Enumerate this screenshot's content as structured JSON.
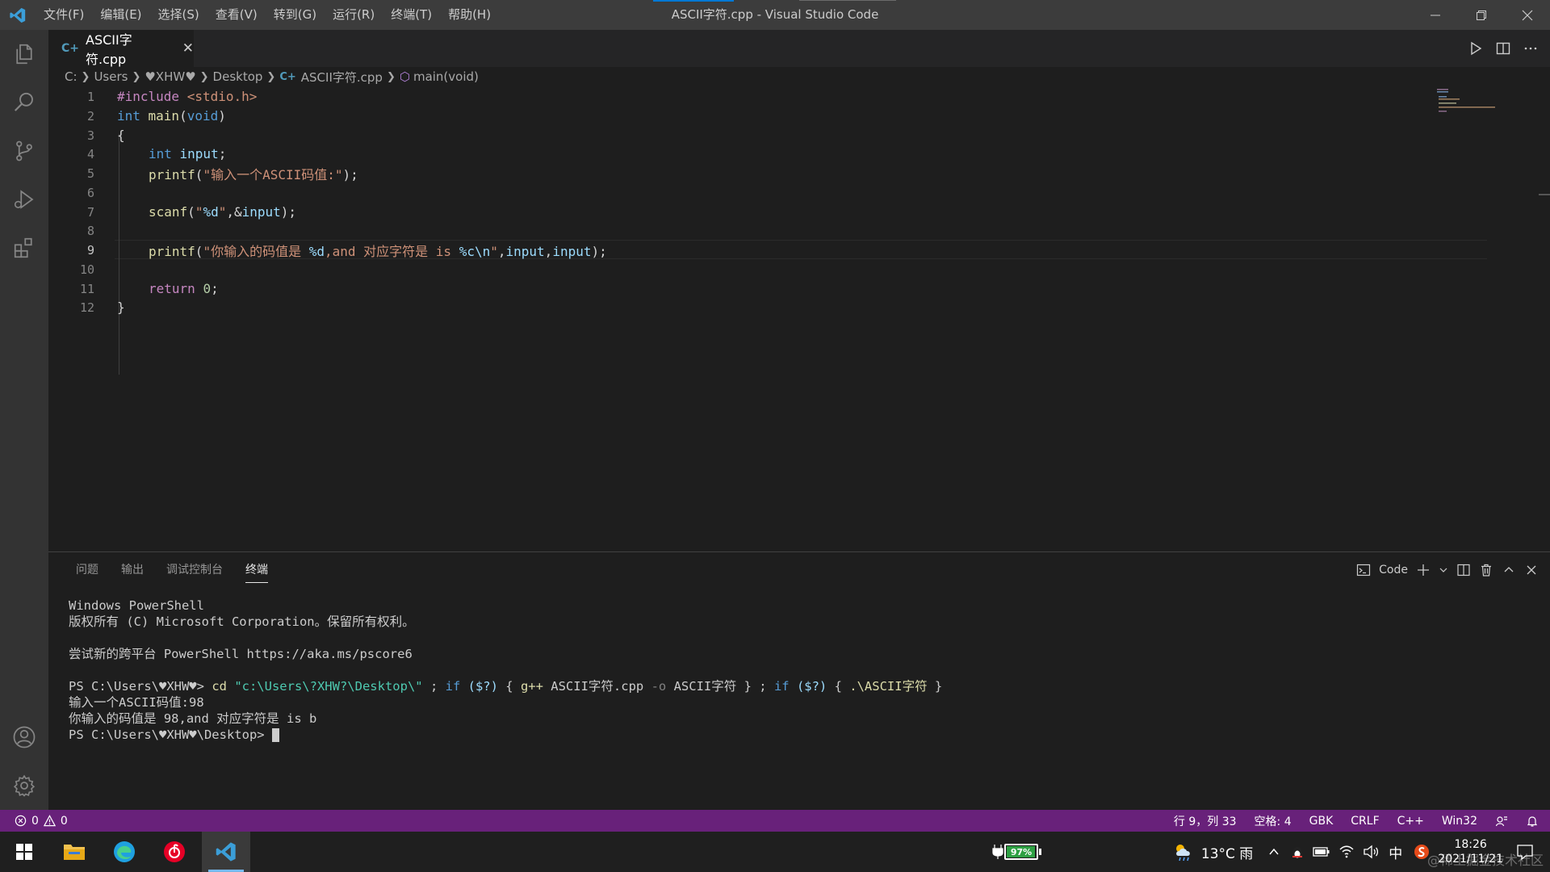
{
  "titlebar": {
    "window_title": "ASCII字符.cpp - Visual Studio Code",
    "menu": [
      "文件(F)",
      "编辑(E)",
      "选择(S)",
      "查看(V)",
      "转到(G)",
      "运行(R)",
      "终端(T)",
      "帮助(H)"
    ]
  },
  "tab": {
    "label": "ASCII字符.cpp",
    "icon": "cpp-file-icon",
    "close": "✕"
  },
  "breadcrumb": {
    "items": [
      "C:",
      "Users",
      "♥XHW♥",
      "Desktop",
      "ASCII字符.cpp",
      "main(void)"
    ]
  },
  "editor": {
    "active_line": 9,
    "line_numbers": [
      "1",
      "2",
      "3",
      "4",
      "5",
      "6",
      "7",
      "8",
      "9",
      "10",
      "11",
      "12"
    ],
    "lines": {
      "l1_pp": "#include ",
      "l1_inc": "<stdio.h>",
      "l2_kw": "int ",
      "l2_fn": "main",
      "l2_p1": "(",
      "l2_kw2": "void",
      "l2_p2": ")",
      "l3": "{",
      "l4_kw": "int ",
      "l4_var": "input",
      "l4_semi": ";",
      "l5_fn": "printf",
      "l5_p": "(",
      "l5_str": "\"输入一个ASCII码值:\"",
      "l5_end": ");",
      "l7_fn": "scanf",
      "l7_p": "(",
      "l7_q1": "\"",
      "l7_fmt": "%d",
      "l7_q2": "\"",
      "l7_rest": ",&",
      "l7_var": "input",
      "l7_end": ");",
      "l9_fn": "printf",
      "l9_p": "(",
      "l9_s1": "\"你输入的码值是 ",
      "l9_f1": "%d",
      "l9_s2": ",and 对应字符是 is ",
      "l9_f2": "%c\\n",
      "l9_s3": "\"",
      "l9_c1": ",",
      "l9_v1": "input",
      "l9_c2": ",",
      "l9_v2": "input",
      "l9_end": ");",
      "l11_kw": "return ",
      "l11_num": "0",
      "l11_semi": ";",
      "l12": "}"
    }
  },
  "panel": {
    "tabs": [
      "问题",
      "输出",
      "调试控制台",
      "终端"
    ],
    "active_tab": "终端",
    "terminal_name": "Code",
    "terminal": {
      "line1": "Windows PowerShell",
      "line2": "版权所有 (C) Microsoft Corporation。保留所有权利。",
      "line3": "尝试新的跨平台 PowerShell https://aka.ms/pscore6",
      "prompt1": "PS C:\\Users\\♥XHW♥> ",
      "cmd_cd": "cd ",
      "cmd_path": "\"c:\\Users\\?XHW?\\Desktop\\\"",
      "cmd_semi1": " ; ",
      "cmd_if1": "if ",
      "cmd_cond1": "($?)",
      "cmd_br1": " { ",
      "cmd_gpp": "g++ ",
      "cmd_src": "ASCII字符.cpp ",
      "cmd_o": "-o ",
      "cmd_out": "ASCII字符",
      "cmd_br2": " } ; ",
      "cmd_if2": "if ",
      "cmd_cond2": "($?)",
      "cmd_br3": " { ",
      "cmd_run": ".\\ASCII字符",
      "cmd_br4": " }",
      "out1": "输入一个ASCII码值:98",
      "out2": "你输入的码值是 98,and 对应字符是 is b",
      "prompt2": "PS C:\\Users\\♥XHW♥\\Desktop> "
    }
  },
  "statusbar": {
    "errors": "0",
    "warnings": "0",
    "position": "行 9，列 33",
    "spaces": "空格: 4",
    "encoding": "GBK",
    "eol": "CRLF",
    "language": "C++",
    "platform": "Win32",
    "accent": "#68217a"
  },
  "taskbar": {
    "battery": "97%",
    "battery_level": 0.97,
    "weather": "13°C 雨",
    "ime": "中",
    "time": "18:26",
    "date": "2021/11/21",
    "watermark": "@稀土掘金技术社区"
  }
}
